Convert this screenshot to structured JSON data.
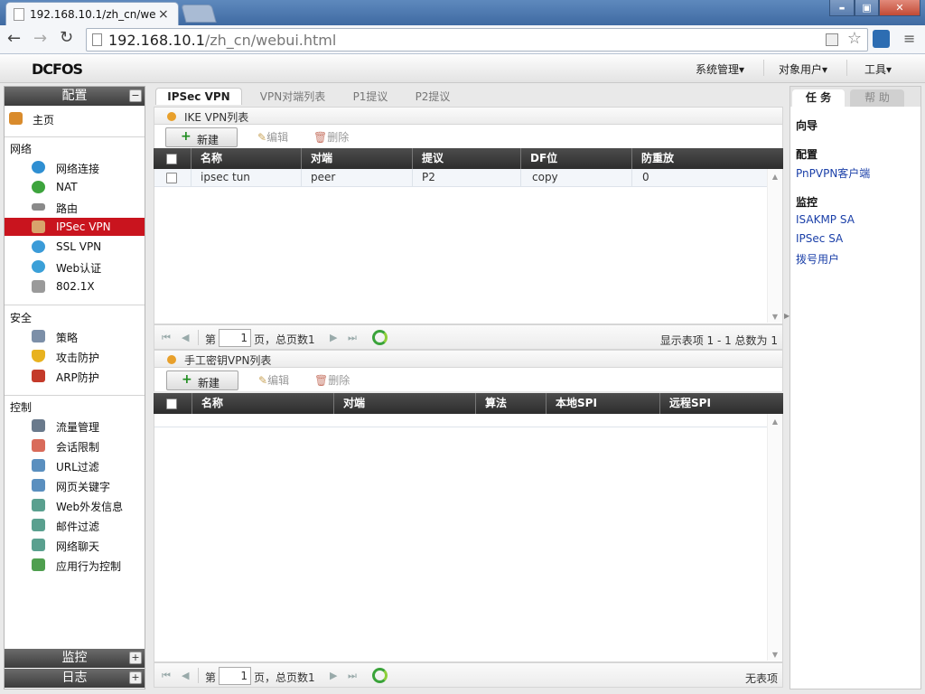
{
  "browser": {
    "tab_title": "192.168.10.1/zh_cn/web",
    "tab_close": "×",
    "url_host": "192.168.10.1",
    "url_path": "/zh_cn/webui.html",
    "win_min": "▬",
    "win_max": "▣",
    "win_close": "✕"
  },
  "app": {
    "logo": "DCFOS",
    "menu": [
      "系统管理▾",
      "对象用户▾",
      "工具▾"
    ]
  },
  "left": {
    "title": "配置",
    "collapse": "−",
    "home": "主页",
    "sections": {
      "network": "网络",
      "security": "安全",
      "control": "控制"
    },
    "network_items": [
      "网络连接",
      "NAT",
      "路由",
      "IPSec VPN",
      "SSL VPN",
      "Web认证",
      "802.1X"
    ],
    "security_items": [
      "策略",
      "攻击防护",
      "ARP防护"
    ],
    "control_items": [
      "流量管理",
      "会话限制",
      "URL过滤",
      "网页关键字",
      "Web外发信息",
      "邮件过滤",
      "网络聊天",
      "应用行为控制"
    ],
    "monitor": "监控",
    "log": "日志",
    "expand": "+"
  },
  "main": {
    "tabs": [
      "IPSec VPN",
      "VPN对端列表",
      "P1提议",
      "P2提议"
    ],
    "ike": {
      "title": "IKE VPN列表",
      "new": "新建",
      "edit": "编辑",
      "delete": "删除",
      "columns": [
        "名称",
        "对端",
        "提议",
        "DF位",
        "防重放"
      ],
      "rows": [
        {
          "name": "ipsec tun",
          "peer": "peer",
          "proposal": "P2",
          "df": "copy",
          "replay": "0"
        }
      ],
      "pager": {
        "prefix": "第",
        "page": "1",
        "suffix": "页，总页数1",
        "status": "显示表项 1 - 1 总数为 1"
      }
    },
    "manual": {
      "title": "手工密钥VPN列表",
      "new": "新建",
      "edit": "编辑",
      "delete": "删除",
      "columns": [
        "名称",
        "对端",
        "算法",
        "本地SPI",
        "远程SPI"
      ],
      "pager": {
        "prefix": "第",
        "page": "1",
        "suffix": "页，总页数1",
        "status": "无表项"
      }
    }
  },
  "right": {
    "tabs": [
      "任 务",
      "帮 助"
    ],
    "wizard": "向导",
    "config": "配置",
    "config_link": "PnPVPN客户端",
    "monitor": "监控",
    "monitor_links": [
      "ISAKMP SA",
      "IPSec SA",
      "拨号用户"
    ]
  },
  "colors": {
    "accent": "#c9141e",
    "header_dark": "#3a3a3a",
    "link": "#1a3fa8"
  }
}
